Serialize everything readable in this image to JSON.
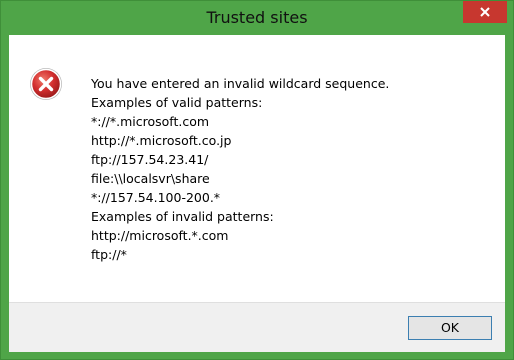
{
  "window": {
    "title": "Trusted sites",
    "close_icon": "close-icon",
    "title_bar_color": "#4fa548",
    "close_button_color": "#c7372f"
  },
  "dialog": {
    "icon": "error-icon",
    "icon_color": "#d32f2f",
    "message_lines": [
      "You have entered an invalid wildcard sequence.",
      "Examples of valid patterns:",
      "*://*.microsoft.com",
      "http://*.microsoft.co.jp",
      "ftp://157.54.23.41/",
      "file:\\\\localsvr\\share",
      "*://157.54.100-200.*",
      "Examples of invalid patterns:",
      "http://microsoft.*.com",
      "ftp://*"
    ]
  },
  "footer": {
    "ok_label": "OK"
  }
}
